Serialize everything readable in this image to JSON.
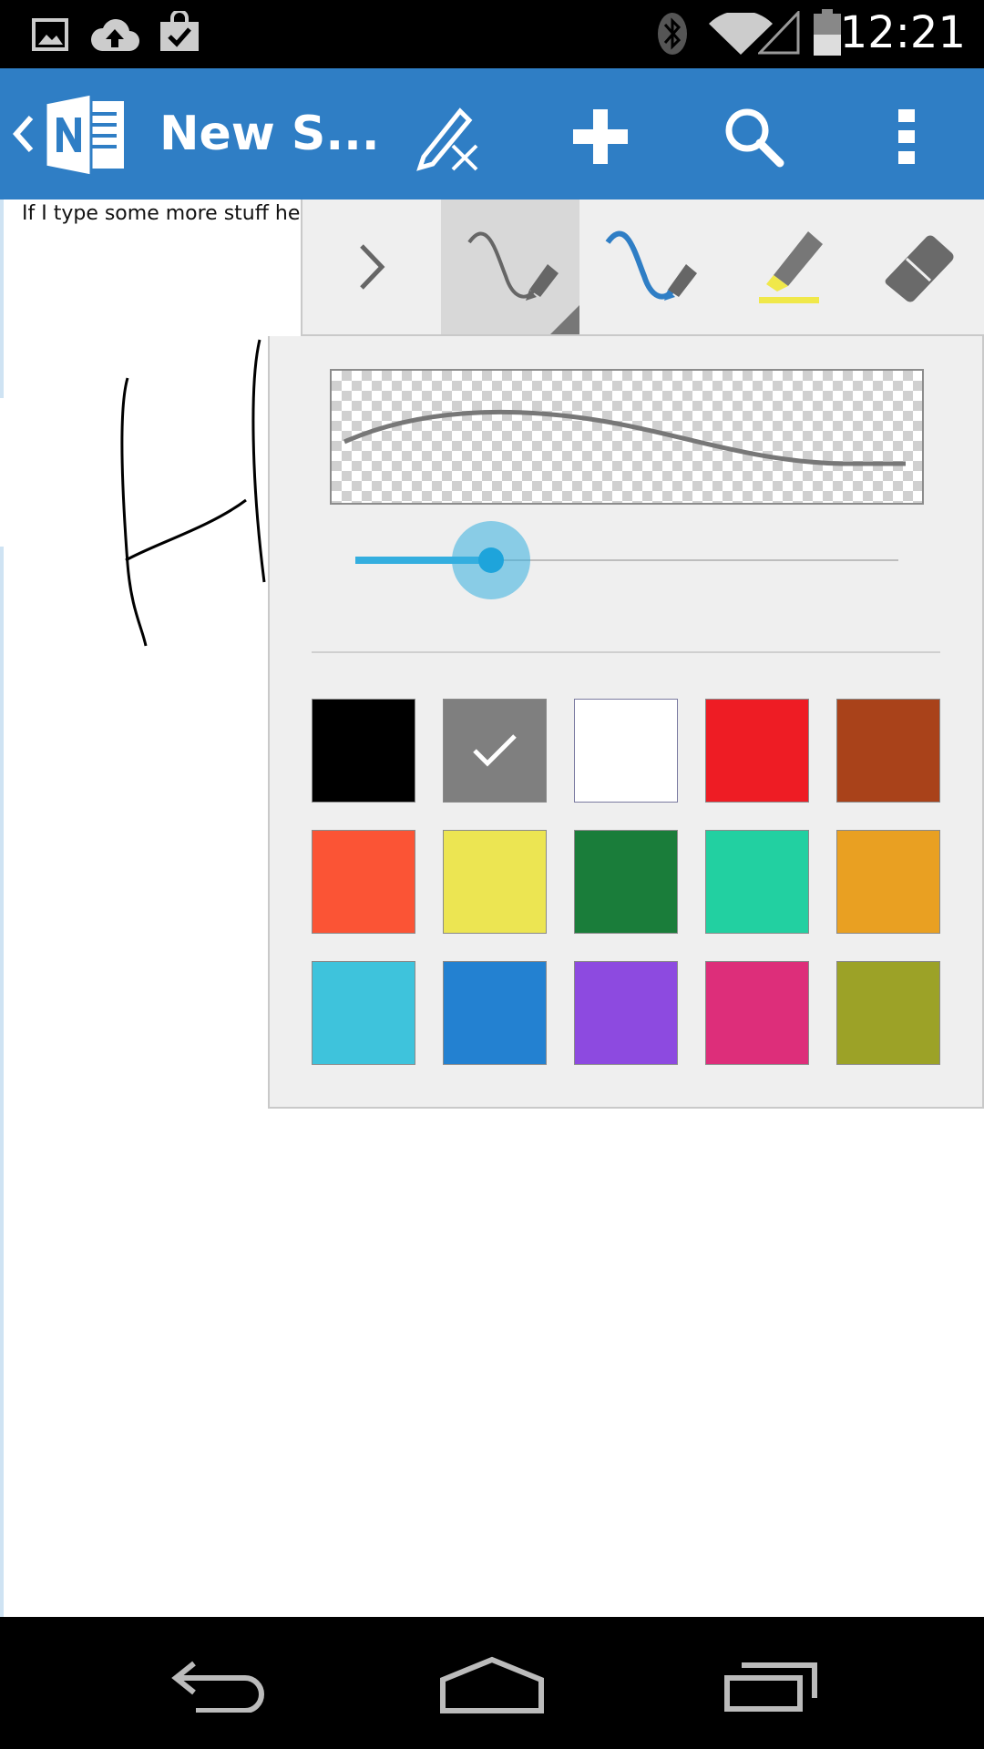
{
  "status_bar": {
    "time": "12:21",
    "left_icons": [
      "gallery-icon",
      "cloud-upload-icon",
      "shopping-bag-check-icon"
    ],
    "right_icons": [
      "bluetooth-icon",
      "wifi-icon",
      "cellular-signal-icon",
      "battery-icon"
    ]
  },
  "app_bar": {
    "title": "New S...",
    "color": "#2f7ec5",
    "actions": [
      "pen-cancel-icon",
      "add-icon",
      "search-icon",
      "overflow-menu-icon"
    ]
  },
  "page": {
    "text": "If I type some more stuff here"
  },
  "pen_toolbar": {
    "tools": [
      "collapse-chevron",
      "pen-gray",
      "pen-blue",
      "highlighter",
      "eraser"
    ],
    "selected_tool": "pen-gray"
  },
  "color_panel": {
    "slider_level": 0.25,
    "selected_color": "#7f7f7f",
    "colors": [
      "#000000",
      "#7f7f7f",
      "#ffffff",
      "#ee1c24",
      "#a9421a",
      "#fb5435",
      "#ece552",
      "#1a7d3a",
      "#22d0a1",
      "#e9a022",
      "#3ec3dc",
      "#2381d1",
      "#8d4ae0",
      "#dd2e7a",
      "#9ca227"
    ]
  },
  "nav_bar": {
    "buttons": [
      "back-icon",
      "home-icon",
      "recent-apps-icon"
    ]
  }
}
